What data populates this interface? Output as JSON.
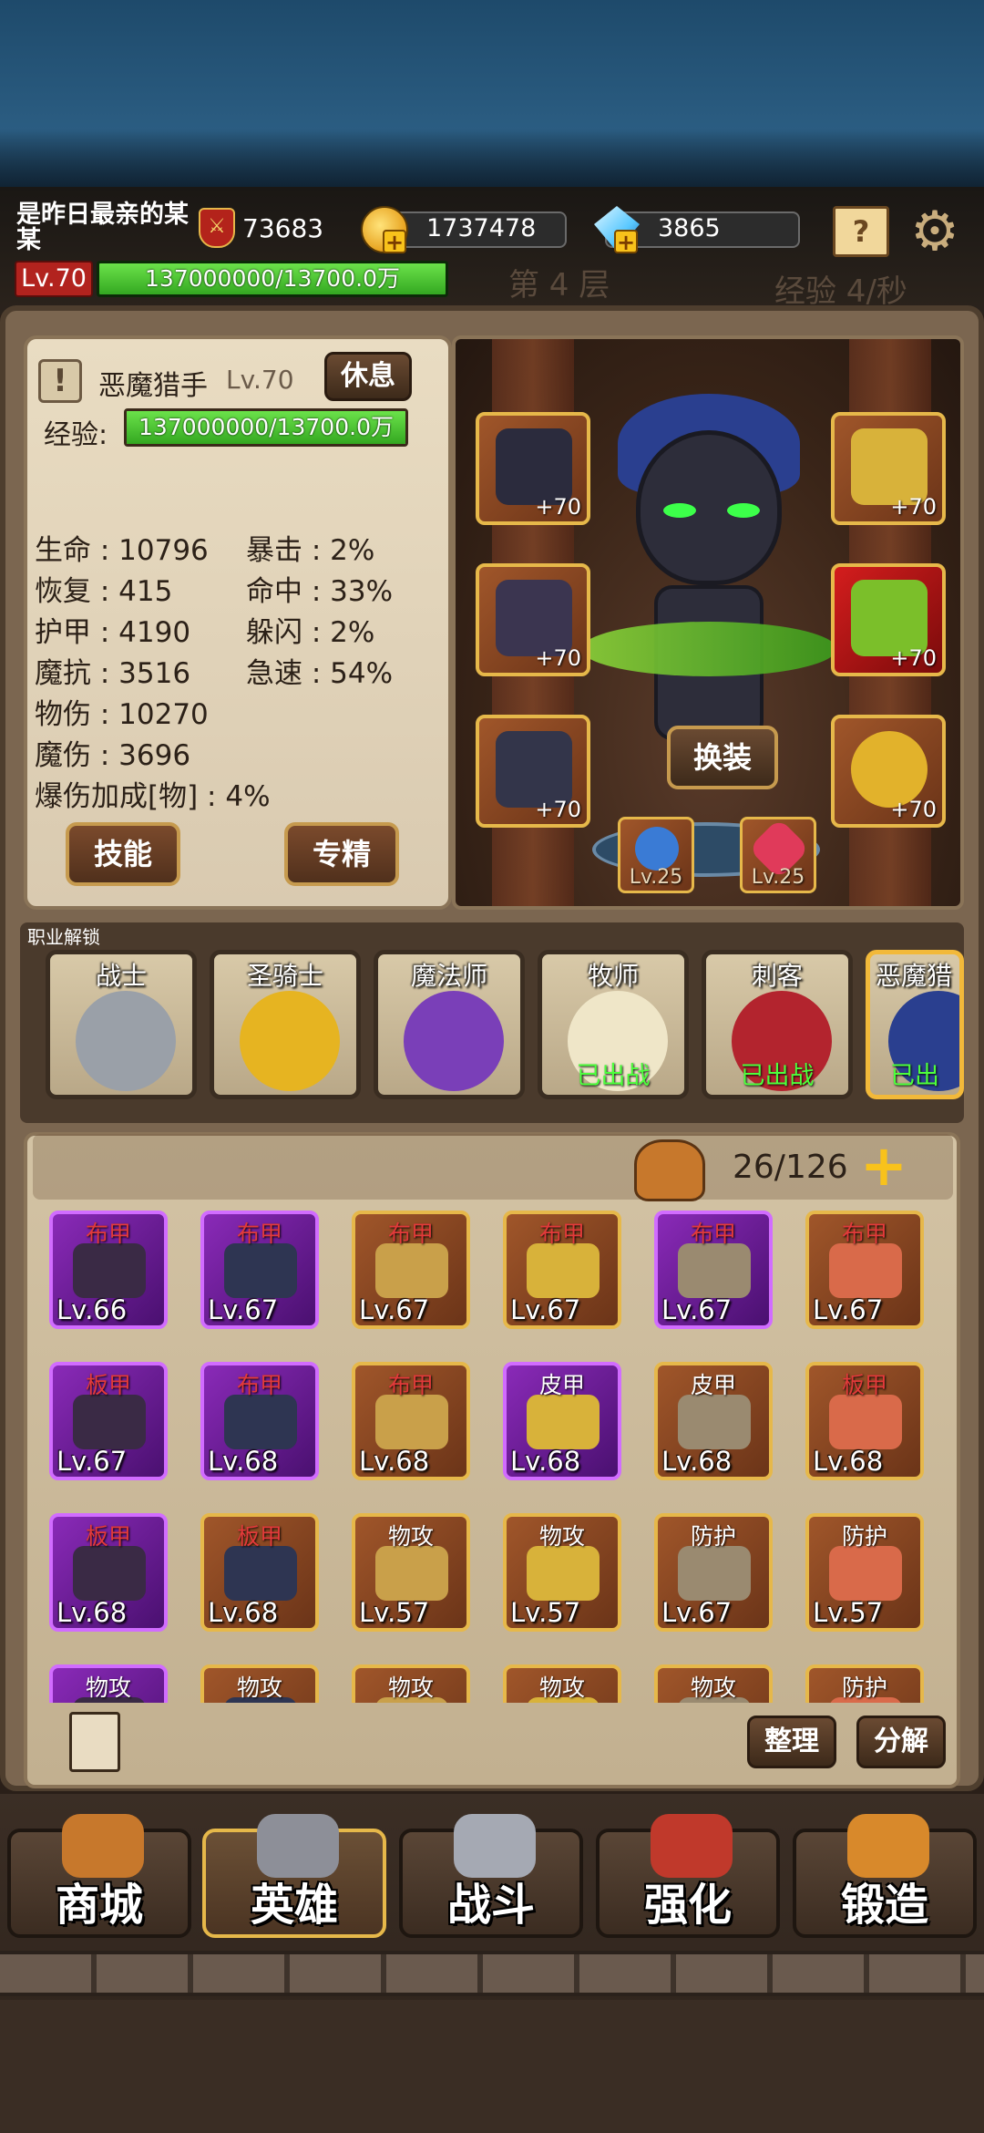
{
  "player": {
    "name": "是昨日最亲的某某",
    "level": "Lv.70",
    "exp_text": "137000000/13700.0万",
    "exp_fraction": 1.0,
    "power": "73683",
    "gold": "1737478",
    "gems": "3865"
  },
  "stage": {
    "floor": "第 4 层",
    "exp_rate": "经验 4/秒"
  },
  "hero": {
    "name": "恶魔猎手",
    "level": "Lv.70",
    "rest_label": "休息",
    "exp_label": "经验:",
    "exp_text": "137000000/13700.0万",
    "stats_left": [
      "生命 : 10796",
      "恢复 : 415",
      "护甲 : 4190",
      "魔抗 : 3516",
      "物伤 : 10270",
      "魔伤 : 3696",
      "爆伤加成[物] : 4%"
    ],
    "stats_right": [
      "暴击 : 2%",
      "命中 : 33%",
      "躲闪 : 2%",
      "急速 : 54%"
    ],
    "skill_label": "技能",
    "mastery_label": "专精",
    "change_label": "换装",
    "equip_levels": [
      "+70",
      "+70",
      "+70",
      "+70",
      "+70",
      "+70"
    ],
    "accessory_levels": [
      "Lv.25",
      "Lv.25"
    ]
  },
  "classes": {
    "title": "职业解锁",
    "items": [
      {
        "name": "战士",
        "status": ""
      },
      {
        "name": "圣骑士",
        "status": ""
      },
      {
        "name": "魔法师",
        "status": ""
      },
      {
        "name": "牧师",
        "status": "已出战"
      },
      {
        "name": "刺客",
        "status": "已出战"
      },
      {
        "name": "恶魔猎",
        "status": "已出"
      }
    ]
  },
  "inventory": {
    "count": "26/126",
    "sort_label": "整理",
    "decompose_label": "分解",
    "items": [
      {
        "type": "布甲",
        "level": "Lv.66",
        "rarity": "purple",
        "red": true
      },
      {
        "type": "布甲",
        "level": "Lv.67",
        "rarity": "purple",
        "red": true
      },
      {
        "type": "布甲",
        "level": "Lv.67",
        "rarity": "orange",
        "red": true
      },
      {
        "type": "布甲",
        "level": "Lv.67",
        "rarity": "orange",
        "red": true
      },
      {
        "type": "布甲",
        "level": "Lv.67",
        "rarity": "purple",
        "red": true
      },
      {
        "type": "布甲",
        "level": "Lv.67",
        "rarity": "orange",
        "red": true
      },
      {
        "type": "板甲",
        "level": "Lv.67",
        "rarity": "purple",
        "red": true
      },
      {
        "type": "布甲",
        "level": "Lv.68",
        "rarity": "purple",
        "red": true
      },
      {
        "type": "布甲",
        "level": "Lv.68",
        "rarity": "orange",
        "red": true
      },
      {
        "type": "皮甲",
        "level": "Lv.68",
        "rarity": "purple",
        "red": false
      },
      {
        "type": "皮甲",
        "level": "Lv.68",
        "rarity": "orange",
        "red": false
      },
      {
        "type": "板甲",
        "level": "Lv.68",
        "rarity": "orange",
        "red": true
      },
      {
        "type": "板甲",
        "level": "Lv.68",
        "rarity": "purple",
        "red": true
      },
      {
        "type": "板甲",
        "level": "Lv.68",
        "rarity": "orange",
        "red": true
      },
      {
        "type": "物攻",
        "level": "Lv.57",
        "rarity": "orange",
        "red": false
      },
      {
        "type": "物攻",
        "level": "Lv.57",
        "rarity": "orange",
        "red": false
      },
      {
        "type": "防护",
        "level": "Lv.67",
        "rarity": "orange",
        "red": false
      },
      {
        "type": "防护",
        "level": "Lv.57",
        "rarity": "orange",
        "red": false
      },
      {
        "type": "物攻",
        "level": "",
        "rarity": "purple",
        "red": false
      },
      {
        "type": "物攻",
        "level": "",
        "rarity": "orange",
        "red": false
      },
      {
        "type": "物攻",
        "level": "",
        "rarity": "orange",
        "red": false
      },
      {
        "type": "物攻",
        "level": "",
        "rarity": "orange",
        "red": false
      },
      {
        "type": "物攻",
        "level": "",
        "rarity": "orange",
        "red": false
      },
      {
        "type": "防护",
        "level": "",
        "rarity": "orange",
        "red": false
      }
    ]
  },
  "nav": {
    "items": [
      "商城",
      "英雄",
      "战斗",
      "强化",
      "锻造"
    ],
    "active_index": 1
  },
  "colors": {
    "exp_green": "#34a821",
    "gold_border": "#e6b84a",
    "purple_rarity": "#8a2ab8",
    "orange_rarity": "#a0562a",
    "deployed_green": "#4dff3c"
  }
}
